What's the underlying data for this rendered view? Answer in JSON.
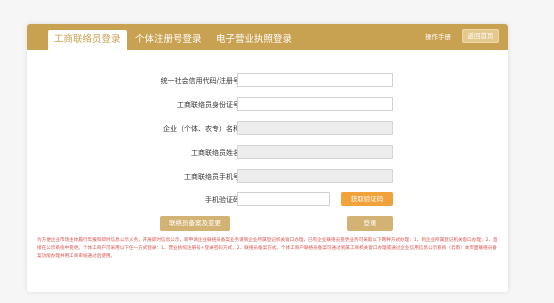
{
  "tabs": [
    {
      "label": "工商联络员登录",
      "active": true
    },
    {
      "label": "个体注册号登录",
      "active": false
    },
    {
      "label": "电子营业执照登录",
      "active": false
    }
  ],
  "header": {
    "manual_label": "操作手册",
    "back_label": "返回首页"
  },
  "form": {
    "credit_code_label": "统一社会信用代码/注册号：",
    "credit_code_value": "",
    "liaison_id_label": "工商联络员身份证号：",
    "liaison_id_value": "",
    "company_name_label": "企业（个体、农专）名称：",
    "company_name_value": "",
    "liaison_name_label": "工商联络员姓名：",
    "liaison_name_value": "",
    "liaison_phone_label": "工商联络员手机号：",
    "liaison_phone_value": "",
    "sms_code_label": "手机验证码：",
    "sms_code_value": "",
    "sms_button_label": "获取验证码"
  },
  "actions": {
    "change_label": "联络员备案及变更",
    "login_label": "登录"
  },
  "notice": "为方便企业市场主体履行年报和即时信息公示义务，开展即时信息公示，新申请企业联络员备案业务请到企业所属登记机关窗口办理，已有企业联络员变更业务可采取以下两种方式办理：1、到企业所属登记机关窗口办理；2、直接在公示系统中变更。个体工商户可采用以下任一方式登录：1、营业执照注册号+登录密码方式，2、联络员备案方式。个体工商户联络员备案可通过到属工商机关窗口办理或通过企业信用信息公示系统（云南）本页面联络员备案功能办理并用工商审核通过后使用。",
  "colors": {
    "brand": "#c8a251",
    "accent_button": "#f2a23a",
    "notice_text": "#d9534f"
  }
}
